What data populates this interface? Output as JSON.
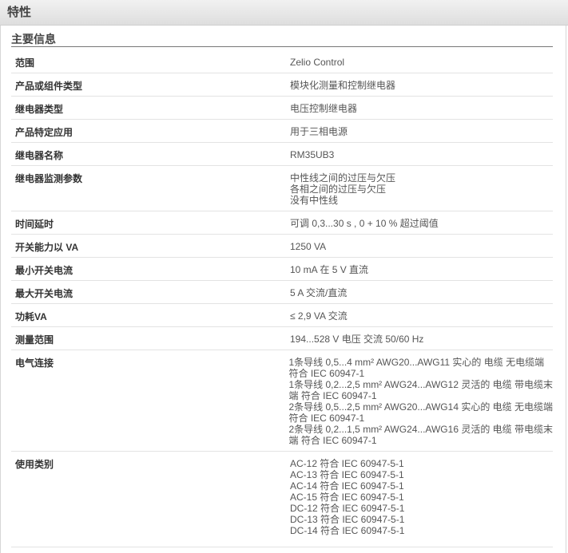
{
  "header": {
    "title": "特性"
  },
  "section": {
    "title": "主要信息"
  },
  "rows": [
    {
      "label": "范围",
      "values": [
        "Zelio Control"
      ]
    },
    {
      "label": "产品或组件类型",
      "values": [
        "模块化测量和控制继电器"
      ]
    },
    {
      "label": "继电器类型",
      "values": [
        "电压控制继电器"
      ]
    },
    {
      "label": "产品特定应用",
      "values": [
        "用于三相电源"
      ]
    },
    {
      "label": "继电器名称",
      "values": [
        "RM35UB3"
      ]
    },
    {
      "label": "继电器监测参数",
      "values": [
        "中性线之间的过压与欠压",
        "各相之间的过压与欠压",
        "没有中性线"
      ]
    },
    {
      "label": "时间延时",
      "values": [
        "可调 0,3...30 s , 0 + 10 % 超过阈值"
      ]
    },
    {
      "label": "开关能力以 VA",
      "values": [
        "1250 VA"
      ]
    },
    {
      "label": "最小开关电流",
      "values": [
        "10 mA 在 5 V 直流"
      ]
    },
    {
      "label": "最大开关电流",
      "values": [
        "5 A 交流/直流"
      ]
    },
    {
      "label": "功耗VA",
      "values": [
        "≤ 2,9 VA 交流"
      ]
    },
    {
      "label": "测量范围",
      "values": [
        "194...528 V 电压 交流 50/60 Hz"
      ]
    },
    {
      "label": "电气连接",
      "values": [
        "1条导线 0,5...4 mm² AWG20...AWG11 实心的 电缆 无电缆端",
        "符合 IEC 60947-1",
        "1条导线 0,2...2,5 mm² AWG24...AWG12 灵活的 电缆 带电缆末",
        "端 符合 IEC 60947-1",
        "2条导线 0,5...2,5 mm² AWG20...AWG14 实心的 电缆 无电缆端",
        "符合 IEC 60947-1",
        "2条导线 0,2...1,5 mm² AWG24...AWG16 灵活的 电缆 带电缆末",
        "端 符合 IEC 60947-1"
      ]
    },
    {
      "label": "使用类别",
      "values": [
        "AC-12 符合 IEC 60947-5-1",
        "AC-13 符合 IEC 60947-5-1",
        "AC-14 符合 IEC 60947-5-1",
        "AC-15 符合 IEC 60947-5-1",
        "DC-12 符合 IEC 60947-5-1",
        "DC-13 符合 IEC 60947-5-1",
        "DC-14 符合 IEC 60947-5-1"
      ]
    }
  ]
}
